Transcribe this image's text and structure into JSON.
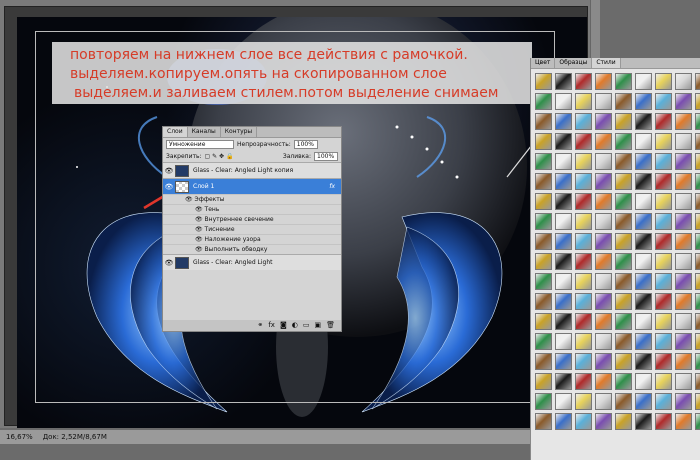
{
  "hint": {
    "line1": "повторяем на нижнем слое все действия с рамочкой.",
    "line2": "выделяем.копируем.опять на скопированном слое",
    "line3": "выделяем.и заливаем стилем.потом выделение снимаем"
  },
  "layers_panel": {
    "tabs": [
      "Слои",
      "Каналы",
      "Контуры"
    ],
    "blend_mode": "Умножение",
    "opacity_label": "Непрозрачность:",
    "opacity_value": "100%",
    "lock_label": "Закрепить:",
    "fill_label": "Заливка:",
    "fill_value": "100%",
    "layers": [
      {
        "name": "Glass - Clear: Angled Light копия",
        "selected": false
      },
      {
        "name": "Слой 1",
        "selected": true
      },
      {
        "name": "Glass - Clear: Angled Light",
        "selected": false
      }
    ],
    "effects_label": "Эффекты",
    "effects": [
      "Тень",
      "Внутреннее свечение",
      "Тиснение",
      "Наложение узора",
      "Выполнить обводку"
    ],
    "fx_badge": "fx"
  },
  "styles_panel": {
    "tabs": [
      "Цвет",
      "Образцы",
      "Стили"
    ]
  },
  "status_bar": {
    "zoom": "16,67%",
    "doc_info": "Док: 2,52M/8,67M"
  }
}
